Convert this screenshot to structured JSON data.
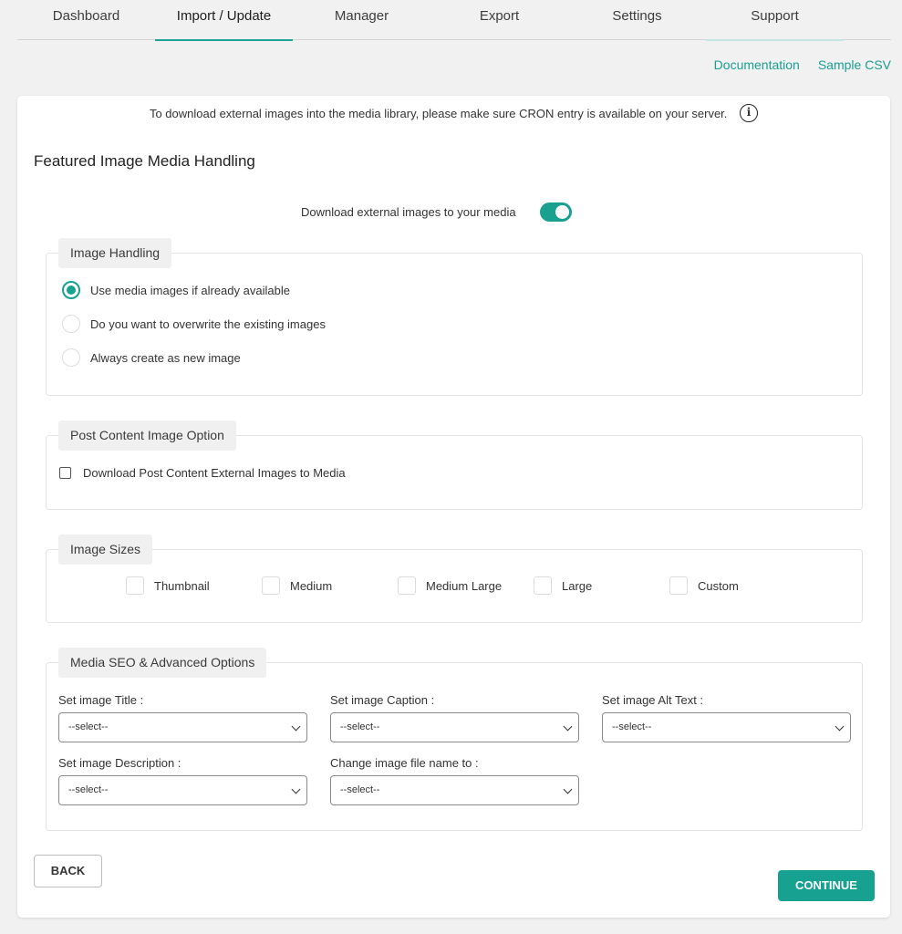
{
  "nav": {
    "tabs": [
      "Dashboard",
      "Import / Update",
      "Manager",
      "Export",
      "Settings",
      "Support"
    ]
  },
  "links": {
    "documentation": "Documentation",
    "sample_csv": "Sample CSV"
  },
  "notice": "To download external images into the media library, please make sure CRON entry is available on your server.",
  "page_title": "Featured Image Media Handling",
  "download_toggle": {
    "label": "Download external images to your media",
    "state": "on"
  },
  "image_handling": {
    "legend": "Image Handling",
    "options": [
      "Use media images if already available",
      "Do you want to overwrite the existing images",
      "Always create as new image"
    ],
    "selected_index": 0
  },
  "post_content": {
    "legend": "Post Content Image Option",
    "checkbox_label": "Download Post Content External Images to Media",
    "checked": false
  },
  "image_sizes": {
    "legend": "Image Sizes",
    "options": [
      "Thumbnail",
      "Medium",
      "Medium Large",
      "Large",
      "Custom"
    ]
  },
  "seo": {
    "legend": "Media SEO & Advanced Options",
    "fields": [
      {
        "label": "Set image Title :",
        "value": "--select--"
      },
      {
        "label": "Set image Caption :",
        "value": "--select--"
      },
      {
        "label": "Set image Alt Text :",
        "value": "--select--"
      },
      {
        "label": "Set image Description :",
        "value": "--select--"
      },
      {
        "label": "Change image file name to :",
        "value": "--select--"
      }
    ]
  },
  "buttons": {
    "back": "BACK",
    "continue": "CONTINUE"
  },
  "colors": {
    "accent": "#16a190",
    "link": "#1a9e92"
  },
  "icons": {
    "info": "info-circle-icon",
    "chevron": "chevron-down-icon"
  }
}
